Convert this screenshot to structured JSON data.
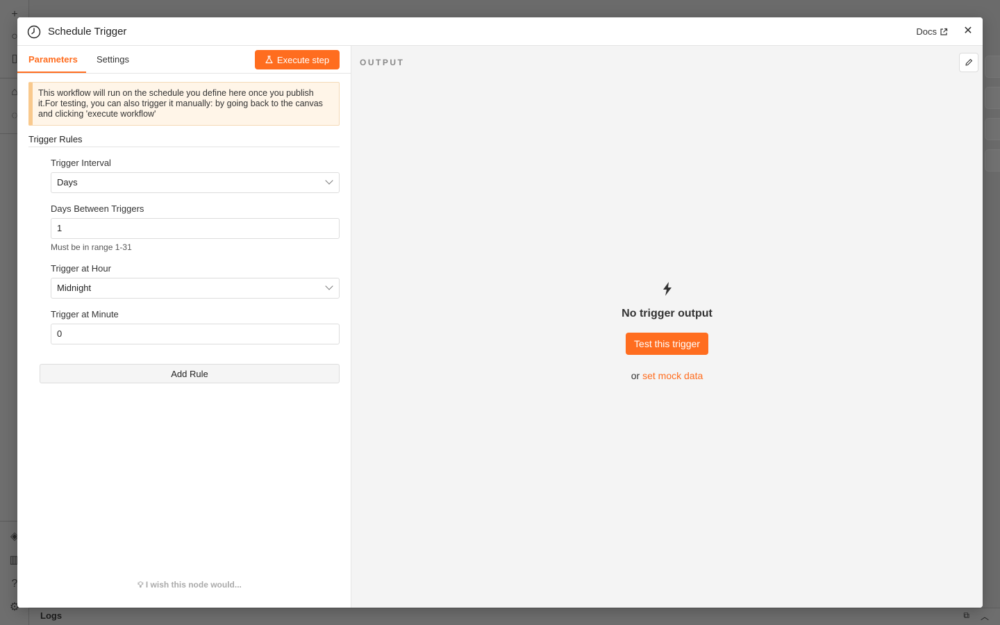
{
  "modal": {
    "title": "Schedule Trigger",
    "docs_label": "Docs"
  },
  "tabs": {
    "parameters": "Parameters",
    "settings": "Settings"
  },
  "execute_step_label": "Execute step",
  "notice_text": "This workflow will run on the schedule you define here once you publish it.For testing, you can also trigger it manually: by going back to the canvas and clicking 'execute workflow'",
  "trigger_rules": {
    "title": "Trigger Rules",
    "fields": {
      "interval": {
        "label": "Trigger Interval",
        "value": "Days"
      },
      "days_between": {
        "label": "Days Between Triggers",
        "value": "1",
        "hint": "Must be in range 1-31"
      },
      "hour": {
        "label": "Trigger at Hour",
        "value": "Midnight"
      },
      "minute": {
        "label": "Trigger at Minute",
        "value": "0"
      }
    },
    "add_rule_label": "Add Rule"
  },
  "feedback_text": "I wish this node would...",
  "output": {
    "label": "OUTPUT",
    "empty_title": "No trigger output",
    "test_button": "Test this trigger",
    "or_text": "or",
    "mock_link": "set mock data"
  },
  "logs_label": "Logs",
  "accent_color": "#ff6d1f"
}
